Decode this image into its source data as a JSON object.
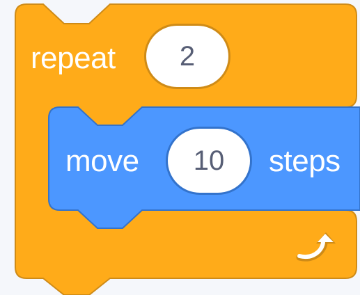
{
  "blocks": {
    "repeat": {
      "label": "repeat",
      "count_value": "2",
      "end_icon": "loop-arrow-icon",
      "color": "#ffab19",
      "border_color": "#cf8b17"
    },
    "move": {
      "label_before": "move",
      "steps_value": "10",
      "label_after": "steps",
      "color": "#4c97ff",
      "border_color": "#3373cc"
    }
  }
}
